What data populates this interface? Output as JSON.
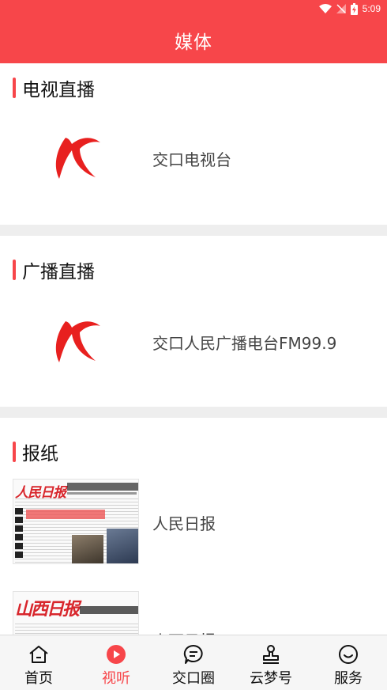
{
  "status_bar": {
    "time": "5:09"
  },
  "header": {
    "title": "媒体"
  },
  "sections": [
    {
      "title": "电视直播",
      "items": [
        {
          "label": "交口电视台",
          "thumb": "k-logo"
        }
      ]
    },
    {
      "title": "广播直播",
      "items": [
        {
          "label": "交口人民广播电台FM99.9",
          "thumb": "k-logo"
        }
      ]
    },
    {
      "title": "报纸",
      "items": [
        {
          "label": "人民日报",
          "thumb": "newspaper",
          "masthead": "人民日报"
        },
        {
          "label": "山西日报",
          "thumb": "newspaper",
          "masthead": "山西日报"
        }
      ]
    }
  ],
  "tabbar": {
    "tabs": [
      {
        "label": "首页",
        "icon": "home-icon"
      },
      {
        "label": "视听",
        "icon": "play-icon",
        "active": true
      },
      {
        "label": "交口圈",
        "icon": "chat-icon"
      },
      {
        "label": "云梦号",
        "icon": "stamp-icon"
      },
      {
        "label": "服务",
        "icon": "smile-icon"
      }
    ]
  },
  "colors": {
    "brand": "#f7464a",
    "divider": "#eeeeee",
    "tabbar_bg": "#f6f6f6"
  }
}
